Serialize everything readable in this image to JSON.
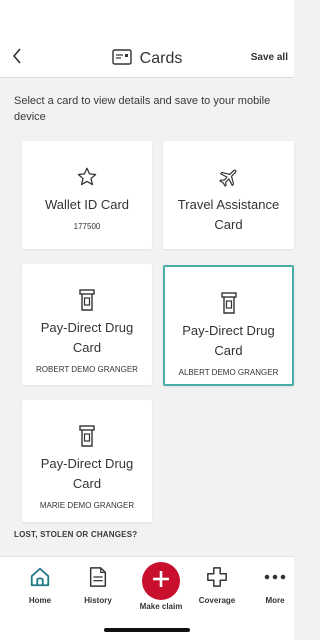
{
  "header": {
    "back_icon": "chevron-left-icon",
    "title": "Cards",
    "title_icon": "card-icon",
    "save_all": "Save all"
  },
  "intro": "Select a card to view details and save to your mobile device",
  "cards": [
    {
      "name": "Wallet ID Card",
      "sub": "177500",
      "icon": "star-icon"
    },
    {
      "name": "Travel Assistance Card",
      "sub": "",
      "icon": "plane-icon"
    },
    {
      "name": "Pay-Direct Drug Card",
      "sub": "ROBERT DEMO GRANGER",
      "icon": "pill-bottle-icon"
    },
    {
      "name": "Pay-Direct Drug Card",
      "sub": "ALBERT DEMO GRANGER",
      "icon": "pill-bottle-icon",
      "selected": true
    },
    {
      "name": "Pay-Direct Drug Card",
      "sub": "MARIE DEMO GRANGER",
      "icon": "pill-bottle-icon"
    }
  ],
  "lost_section": "LOST, STOLEN OR CHANGES?",
  "tabs": {
    "home": "Home",
    "history": "History",
    "claim": "Make claim",
    "coverage": "Coverage",
    "more": "More"
  },
  "colors": {
    "accent": "#c8102e",
    "selected_border": "#4aaea7",
    "home_icon": "#1f7a86"
  }
}
